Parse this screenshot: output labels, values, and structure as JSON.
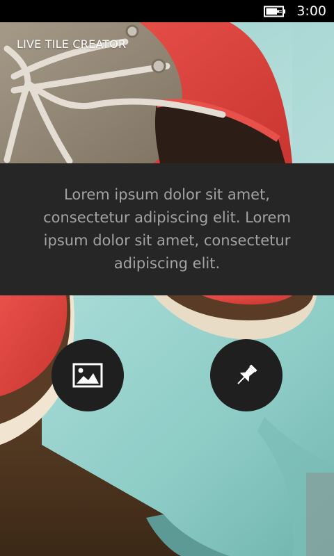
{
  "status_bar": {
    "time": "3:00",
    "battery_icon": "battery-charging-icon"
  },
  "app": {
    "title": "LIVE TILE CREATOR"
  },
  "panel": {
    "text": "Lorem ipsum dolor sit amet, consectetur adipiscing elit. Lorem ipsum dolor sit amet, consectetur adipiscing elit."
  },
  "actions": {
    "image_icon": "image-icon",
    "pin_icon": "pin-icon"
  },
  "colors": {
    "panel_background": "#262626",
    "panel_text": "#a3a3a3",
    "button_background": "#1f1f1f",
    "status_bar": "#000000"
  }
}
